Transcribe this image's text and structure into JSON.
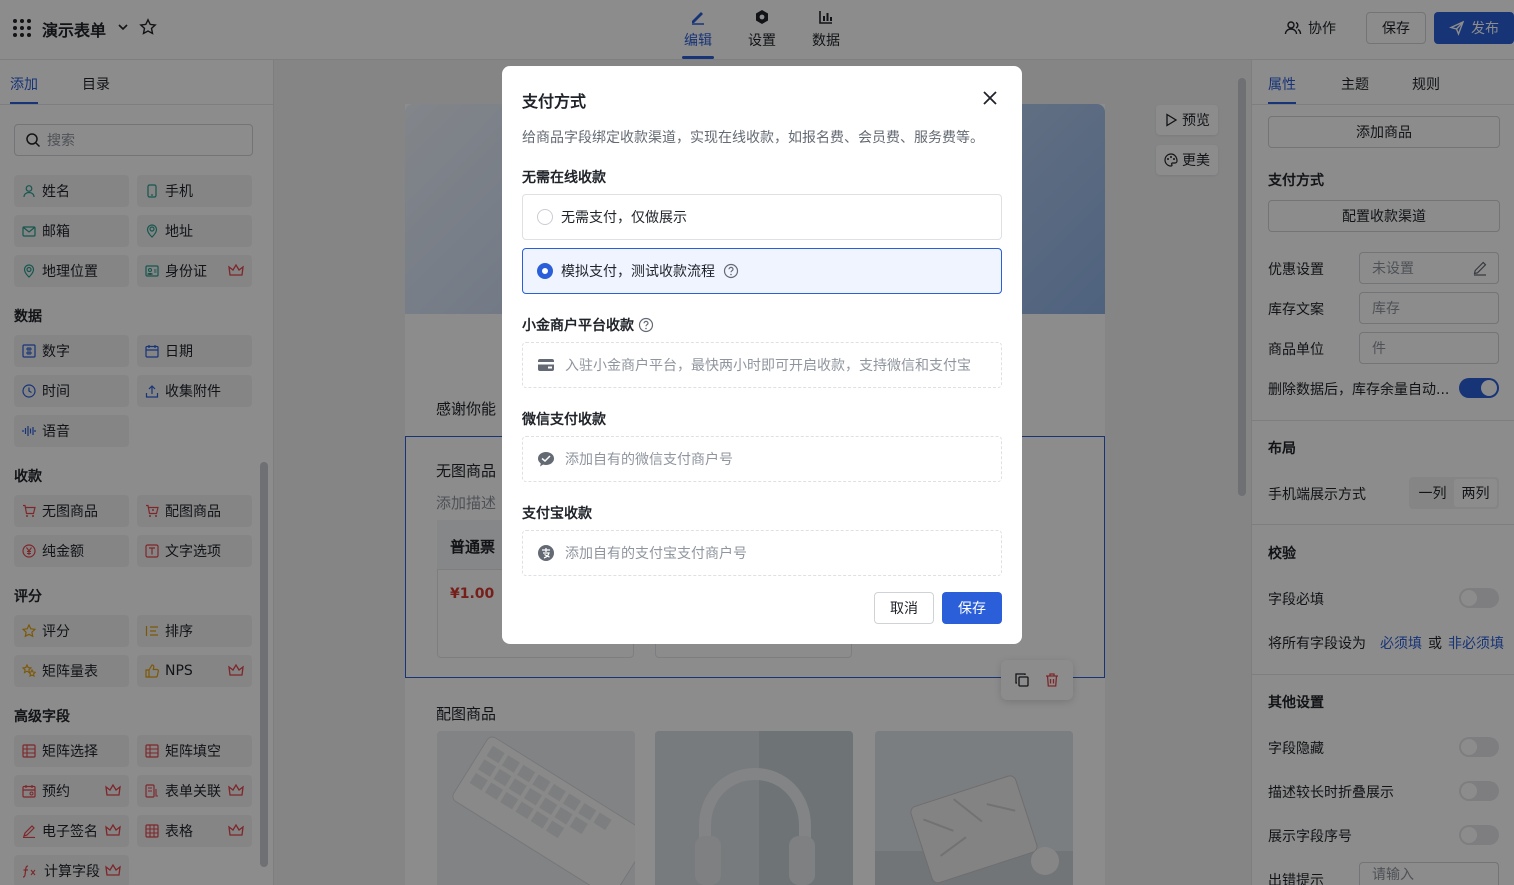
{
  "topbar": {
    "form_title": "演示表单",
    "tabs": [
      {
        "label": "编辑"
      },
      {
        "label": "设置"
      },
      {
        "label": "数据"
      }
    ],
    "collab_label": "协作",
    "save_label": "保存",
    "publish_label": "发布"
  },
  "left": {
    "tabs": [
      {
        "label": "添加"
      },
      {
        "label": "目录"
      }
    ],
    "search_placeholder": "搜索",
    "items": {
      "name": "姓名",
      "phone": "手机",
      "email": "邮箱",
      "address": "地址",
      "geo": "地理位置",
      "idcard": "身份证",
      "number": "数字",
      "date": "日期",
      "time": "时间",
      "attach": "收集附件",
      "voice": "语音",
      "nopic": "无图商品",
      "picgoods": "配图商品",
      "amount": "纯金额",
      "textopt": "文字选项",
      "rating": "评分",
      "sort": "排序",
      "matrix_scale": "矩阵量表",
      "nps": "NPS",
      "matrix_select": "矩阵选择",
      "matrix_fill": "矩阵填空",
      "booking": "预约",
      "formlink": "表单关联",
      "esign": "电子签名",
      "table": "表格",
      "calc": "计算字段"
    },
    "sections": {
      "data": "数据",
      "collect": "收款",
      "score": "评分",
      "advanced": "高级字段"
    }
  },
  "canvas": {
    "preview_label": "预览",
    "beautify_label": "更美",
    "thanks_text": "感谢你能",
    "nopic_title": "无图商品",
    "add_desc": "添加描述",
    "ticket_name": "普通票",
    "ticket_price": "¥1.00",
    "picgoods_title": "配图商品"
  },
  "right": {
    "tabs": [
      {
        "label": "属性"
      },
      {
        "label": "主题"
      },
      {
        "label": "规则"
      }
    ],
    "add_goods": "添加商品",
    "payment_head": "支付方式",
    "config_channel": "配置收款渠道",
    "discount_label": "优惠设置",
    "discount_value": "未设置",
    "stock_label": "库存文案",
    "stock_placeholder": "库存",
    "unit_label": "商品单位",
    "unit_placeholder": "件",
    "delete_label": "删除数据后，库存余量自动...",
    "layout_head": "布局",
    "mobile_label": "手机端展示方式",
    "mobile_options": [
      "一列",
      "两列"
    ],
    "validate_head": "校验",
    "required_label": "字段必填",
    "set_all_label": "将所有字段设为",
    "required_link": "必须填",
    "or_label": "或",
    "optional_link": "非必须填",
    "other_head": "其他设置",
    "hide_label": "字段隐藏",
    "fold_label": "描述较长时折叠展示",
    "seq_label": "展示字段序号",
    "error_label": "出错提示",
    "error_placeholder": "请输入"
  },
  "modal": {
    "title": "支付方式",
    "description": "给商品字段绑定收款渠道，实现在线收款，如报名费、会员费、服务费等。",
    "no_online_head": "无需在线收款",
    "opt_none": "无需支付，仅做展示",
    "opt_mock": "模拟支付，测试收款流程",
    "merchant_head": "小金商户平台收款",
    "merchant_text": "入驻小金商户平台，最快两小时即可开启收款，支持微信和支付宝",
    "wechat_head": "微信支付收款",
    "wechat_text": "添加自有的微信支付商户号",
    "alipay_head": "支付宝收款",
    "alipay_text": "添加自有的支付宝支付商户号",
    "cancel_label": "取消",
    "save_label": "保存"
  },
  "colors": {
    "accent": "#2b5fd9",
    "crown": "#e5484d",
    "price": "#d83931"
  }
}
